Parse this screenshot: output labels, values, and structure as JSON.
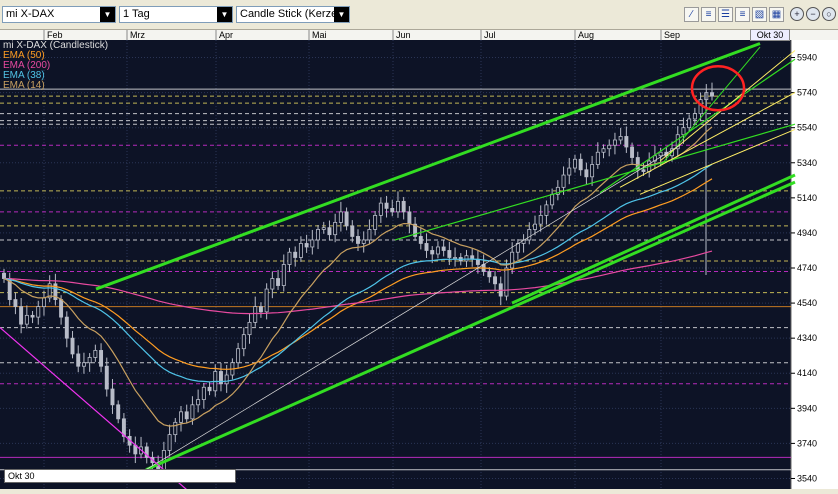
{
  "toolbar": {
    "symbol_value": "mi X-DAX",
    "period_value": "1 Tag",
    "charttype_value": "Candle Stick (Kerze",
    "tool_icons": [
      "draw-line-icon",
      "draw-channel-icon",
      "fibonacci-icon",
      "text-icon",
      "ruler-icon",
      "marker-icon"
    ],
    "zoom_icons": [
      "zoom-in-icon",
      "zoom-out-icon",
      "zoom-reset-icon"
    ]
  },
  "legend": {
    "title": "mi X-DAX (Candlestick)",
    "items": [
      {
        "label": "EMA (50)",
        "color": "#ff9d22"
      },
      {
        "label": "EMA (200)",
        "color": "#e84aa0"
      },
      {
        "label": "EMA (38)",
        "color": "#4fc3e8"
      },
      {
        "label": "EMA (14)",
        "color": "#c8a060"
      }
    ]
  },
  "crosshair_date": "Okt 30",
  "bottom_date": "Okt 30",
  "chart_data": {
    "type": "candlestick",
    "instrument": "mi X-DAX",
    "x_months": [
      "Feb",
      "Mrz",
      "Apr",
      "Mai",
      "Jun",
      "Jul",
      "Aug",
      "Sep"
    ],
    "y_ticks": [
      3540,
      3740,
      3940,
      4140,
      4340,
      4540,
      4740,
      4940,
      5140,
      5340,
      5540,
      5740,
      5940
    ],
    "ylim": [
      3480,
      6040
    ],
    "grid": true,
    "colors": {
      "background": "#0d1326",
      "candle": "#b8bcc8",
      "channel": "#33dd22",
      "trend_yellow": "#ffee66",
      "level_magenta": "#ee33ee",
      "level_white": "#ffffff",
      "level_orange": "#ff9922",
      "highlight": "#ff2222"
    },
    "emas": [
      {
        "name": "EMA (50)",
        "color": "#ff9d22"
      },
      {
        "name": "EMA (200)",
        "color": "#e84aa0"
      },
      {
        "name": "EMA (38)",
        "color": "#4fc3e8"
      },
      {
        "name": "EMA (14)",
        "color": "#c8a060"
      }
    ],
    "horizontal_levels": [
      {
        "value": 5760,
        "color": "#ffffff",
        "style": "solid"
      },
      {
        "value": 5720,
        "color": "#ffee66",
        "style": "dashed"
      },
      {
        "value": 5680,
        "color": "#ffee66",
        "style": "dashed"
      },
      {
        "value": 5620,
        "color": "#ffffff",
        "style": "dashed"
      },
      {
        "value": 5580,
        "color": "#ffffff",
        "style": "dashed"
      },
      {
        "value": 5560,
        "color": "#ffffff",
        "style": "dashed"
      },
      {
        "value": 5440,
        "color": "#ee33ee",
        "style": "dashed"
      },
      {
        "value": 5180,
        "color": "#ffee66",
        "style": "dashed"
      },
      {
        "value": 5060,
        "color": "#ee33ee",
        "style": "dashed"
      },
      {
        "value": 4980,
        "color": "#ffee66",
        "style": "dashed"
      },
      {
        "value": 4900,
        "color": "#ffffff",
        "style": "dashed"
      },
      {
        "value": 4780,
        "color": "#ffee66",
        "style": "dashed"
      },
      {
        "value": 4720,
        "color": "#ee33ee",
        "style": "dashed"
      },
      {
        "value": 4600,
        "color": "#ffee66",
        "style": "dashed"
      },
      {
        "value": 4520,
        "color": "#ff9922",
        "style": "solid"
      },
      {
        "value": 4400,
        "color": "#ffffff",
        "style": "dashed"
      },
      {
        "value": 4200,
        "color": "#ffffff",
        "style": "dashed"
      },
      {
        "value": 4080,
        "color": "#ee33ee",
        "style": "dashed"
      },
      {
        "value": 3660,
        "color": "#ee33ee",
        "style": "solid"
      },
      {
        "value": 3590,
        "color": "#ffffff",
        "style": "solid"
      }
    ],
    "closes": [
      4680,
      4560,
      4520,
      4420,
      4470,
      4460,
      4520,
      4570,
      4650,
      4560,
      4460,
      4340,
      4250,
      4180,
      4200,
      4230,
      4270,
      4180,
      4050,
      3960,
      3880,
      3780,
      3730,
      3680,
      3720,
      3660,
      3630,
      3590,
      3700,
      3790,
      3860,
      3920,
      3880,
      3960,
      3990,
      4060,
      4040,
      4150,
      4080,
      4130,
      4200,
      4280,
      4360,
      4430,
      4520,
      4490,
      4620,
      4680,
      4640,
      4760,
      4830,
      4800,
      4880,
      4860,
      4900,
      4960,
      4970,
      4930,
      5000,
      5060,
      4980,
      4920,
      4880,
      4900,
      4960,
      5040,
      5110,
      5080,
      5060,
      5120,
      5060,
      4990,
      4920,
      4880,
      4840,
      4820,
      4860,
      4840,
      4800,
      4800,
      4780,
      4810,
      4790,
      4760,
      4720,
      4690,
      4650,
      4580,
      4740,
      4830,
      4880,
      4900,
      4960,
      4990,
      5040,
      5100,
      5160,
      5200,
      5270,
      5310,
      5360,
      5300,
      5260,
      5330,
      5400,
      5420,
      5440,
      5470,
      5490,
      5430,
      5370,
      5300,
      5290,
      5350,
      5380,
      5400,
      5380,
      5420,
      5500,
      5540,
      5590,
      5620,
      5700,
      5740,
      5720
    ]
  }
}
